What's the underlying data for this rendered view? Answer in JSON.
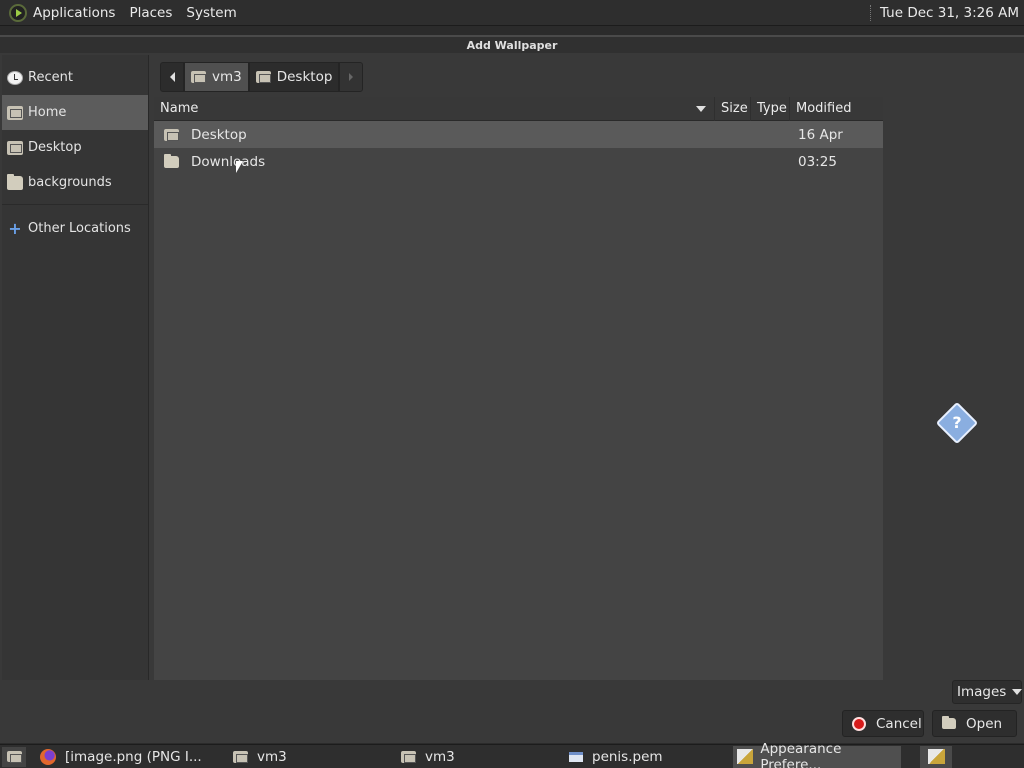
{
  "top_panel": {
    "menus": [
      "Applications",
      "Places",
      "System"
    ],
    "clock": "Tue Dec 31,  3:26 AM"
  },
  "dialog": {
    "title": "Add Wallpaper",
    "sidebar": [
      {
        "label": "Recent",
        "icon": "clock-icon",
        "selected": false
      },
      {
        "label": "Home",
        "icon": "home-folder-icon",
        "selected": true
      },
      {
        "label": "Desktop",
        "icon": "desktop-folder-icon",
        "selected": false
      },
      {
        "label": "backgrounds",
        "icon": "folder-icon",
        "selected": false
      },
      {
        "label": "Other Locations",
        "icon": "plus-icon",
        "selected": false
      }
    ],
    "path": [
      "vm3",
      "Desktop"
    ],
    "columns": {
      "name": "Name",
      "size": "Size",
      "type": "Type",
      "modified": "Modified"
    },
    "files": [
      {
        "name": "Desktop",
        "size": "",
        "type": "",
        "modified": "16 Apr",
        "selected": true
      },
      {
        "name": "Downloads",
        "size": "",
        "type": "",
        "modified": "03:25",
        "selected": false
      }
    ],
    "filter": "Images",
    "buttons": {
      "cancel": "Cancel",
      "open": "Open"
    }
  },
  "taskbar": {
    "items": [
      {
        "label": "[image.png (PNG I...",
        "icon": "firefox-icon",
        "active": false
      },
      {
        "label": "vm3",
        "icon": "home-folder-icon",
        "active": false
      },
      {
        "label": "vm3",
        "icon": "home-folder-icon",
        "active": false
      },
      {
        "label": "penis.pem",
        "icon": "window-icon",
        "active": false
      },
      {
        "label": "Appearance Prefere...",
        "icon": "appearance-icon",
        "active": true
      }
    ]
  },
  "colors": {
    "accent_selection": "#5c5c5c",
    "cancel_icon": "#d81a1a",
    "help_icon": "#8aaee0"
  }
}
